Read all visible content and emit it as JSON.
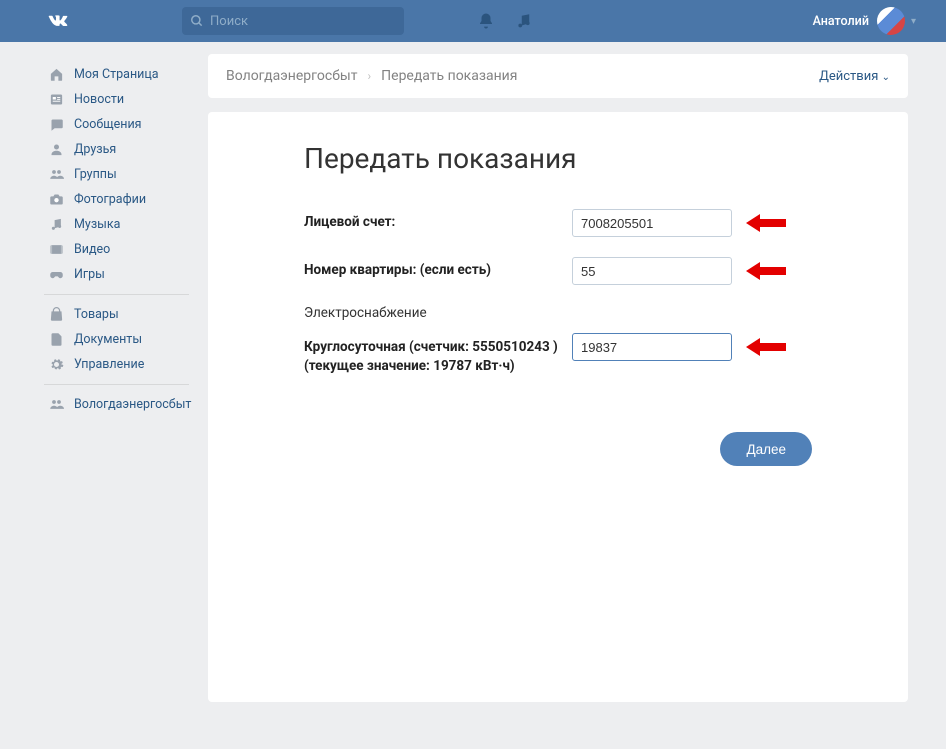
{
  "topbar": {
    "search_placeholder": "Поиск",
    "username": "Анатолий"
  },
  "sidebar": {
    "items": [
      {
        "label": "Моя Страница"
      },
      {
        "label": "Новости"
      },
      {
        "label": "Сообщения"
      },
      {
        "label": "Друзья"
      },
      {
        "label": "Группы"
      },
      {
        "label": "Фотографии"
      },
      {
        "label": "Музыка"
      },
      {
        "label": "Видео"
      },
      {
        "label": "Игры"
      }
    ],
    "items2": [
      {
        "label": "Товары"
      },
      {
        "label": "Документы"
      },
      {
        "label": "Управление"
      }
    ],
    "items3": [
      {
        "label": "Вологдаэнергосбыт"
      }
    ]
  },
  "breadcrumb": {
    "root": "Вологдаэнергосбыт",
    "current": "Передать показания",
    "actions": "Действия"
  },
  "page": {
    "title": "Передать показания",
    "account_label": "Лицевой счет:",
    "account_value": "7008205501",
    "apartment_label": "Номер квартиры: (если есть)",
    "apartment_value": "55",
    "supply_section": "Электроснабжение",
    "meter_label_1": "Круглосуточная (счетчик: 5550510243 )",
    "meter_label_2": "(текущее значение: 19787 кВт·ч)",
    "meter_value": "19837",
    "next_button": "Далее"
  }
}
